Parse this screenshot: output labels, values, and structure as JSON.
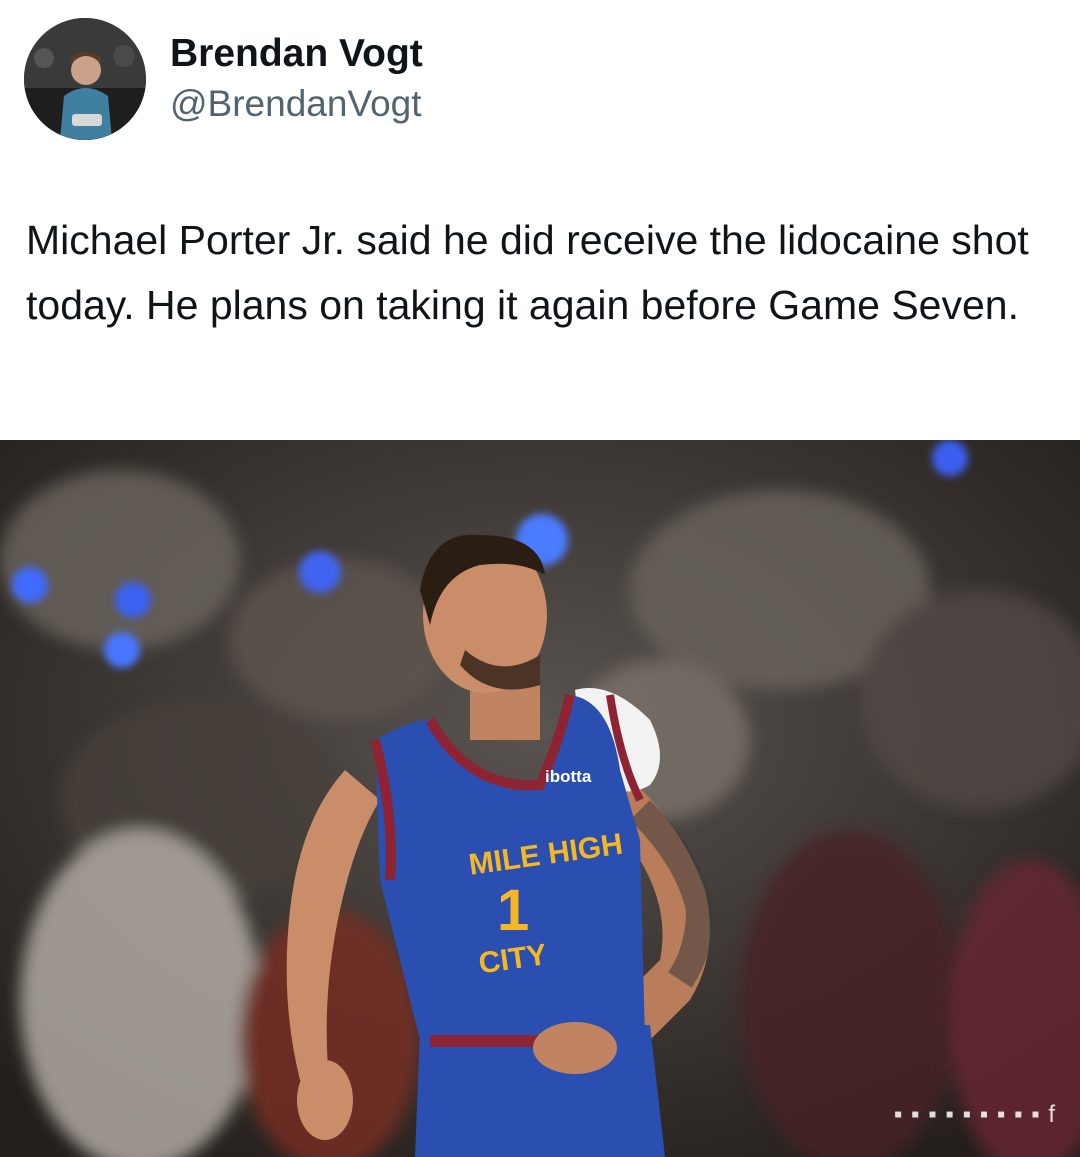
{
  "tweet": {
    "author": {
      "display_name": "Brendan Vogt",
      "handle": "@BrendanVogt"
    },
    "text": "Michael Porter Jr. said he did receive the lidocaine shot today. He plans on taking it again before Game Seven.",
    "media": {
      "jersey_sponsor": "ibotta",
      "jersey_wordmark_top": "MILE HIGH",
      "jersey_wordmark_bottom": "CITY",
      "jersey_number": "1"
    }
  },
  "colors": {
    "text_primary": "#0f1419",
    "text_secondary": "#536471",
    "jersey_blue": "#2a4fb0",
    "jersey_gold": "#f5b724",
    "jersey_red": "#8e2433"
  }
}
